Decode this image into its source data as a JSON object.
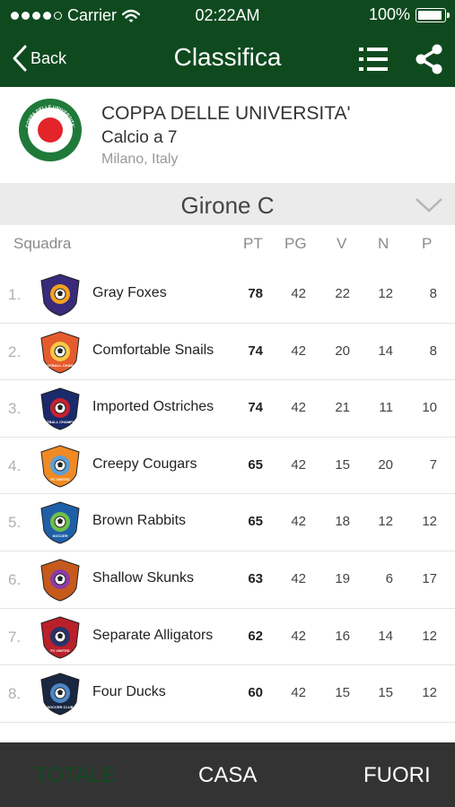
{
  "status_bar": {
    "carrier": "Carrier",
    "time": "02:22AM",
    "battery": "100%",
    "battery_level": 1.0
  },
  "nav": {
    "back_label": "Back",
    "title": "Classifica"
  },
  "competition": {
    "logo_text": "COPPA DELLE UNIVERSITA'",
    "name": "COPPA DELLE UNIVERSITA'",
    "sport": "Calcio a 7",
    "location": "Milano, Italy"
  },
  "group": {
    "title": "Girone C"
  },
  "columns": {
    "team": "Squadra",
    "pt": "PT",
    "pg": "PG",
    "v": "V",
    "n": "N",
    "p": "P"
  },
  "teams": [
    {
      "rank": "1.",
      "name": "Gray Foxes",
      "pt": "78",
      "pg": "42",
      "v": "22",
      "n": "12",
      "p": "8",
      "crest": "crest-badge-icon",
      "crest_text": ""
    },
    {
      "rank": "2.",
      "name": "Comfortable Snails",
      "pt": "74",
      "pg": "42",
      "v": "20",
      "n": "14",
      "p": "8",
      "crest": "crest-shield-icon",
      "crest_text": "FOOTBALL CHAMPS"
    },
    {
      "rank": "3.",
      "name": "Imported Ostriches",
      "pt": "74",
      "pg": "42",
      "v": "21",
      "n": "11",
      "p": "10",
      "crest": "crest-champions-icon",
      "crest_text": "FOOTBALL CHAMPIONS"
    },
    {
      "rank": "4.",
      "name": "Creepy Cougars",
      "pt": "65",
      "pg": "42",
      "v": "15",
      "n": "20",
      "p": "7",
      "crest": "crest-fc-united-icon",
      "crest_text": "FC UNITED"
    },
    {
      "rank": "5.",
      "name": "Brown Rabbits",
      "pt": "65",
      "pg": "42",
      "v": "18",
      "n": "12",
      "p": "12",
      "crest": "crest-soccer-icon",
      "crest_text": "SOCCER"
    },
    {
      "rank": "6.",
      "name": "Shallow Skunks",
      "pt": "63",
      "pg": "42",
      "v": "19",
      "n": "6",
      "p": "17",
      "crest": "crest-shield-icon",
      "crest_text": ""
    },
    {
      "rank": "7.",
      "name": "Separate Alligators",
      "pt": "62",
      "pg": "42",
      "v": "16",
      "n": "14",
      "p": "12",
      "crest": "crest-fc-united-icon",
      "crest_text": "FC UNITED"
    },
    {
      "rank": "8.",
      "name": "Four Ducks",
      "pt": "60",
      "pg": "42",
      "v": "15",
      "n": "15",
      "p": "12",
      "crest": "crest-soccer-club-icon",
      "crest_text": "SOCCER CLUB"
    }
  ],
  "tabs": {
    "total": "TOTALE",
    "home": "CASA",
    "away": "FUORI"
  },
  "colors": {
    "primary": "#0f4a1f",
    "group_bar": "#ebebeb",
    "tabbar": "#333333",
    "logo_red": "#e3242b",
    "logo_green": "#1f7a3a"
  }
}
